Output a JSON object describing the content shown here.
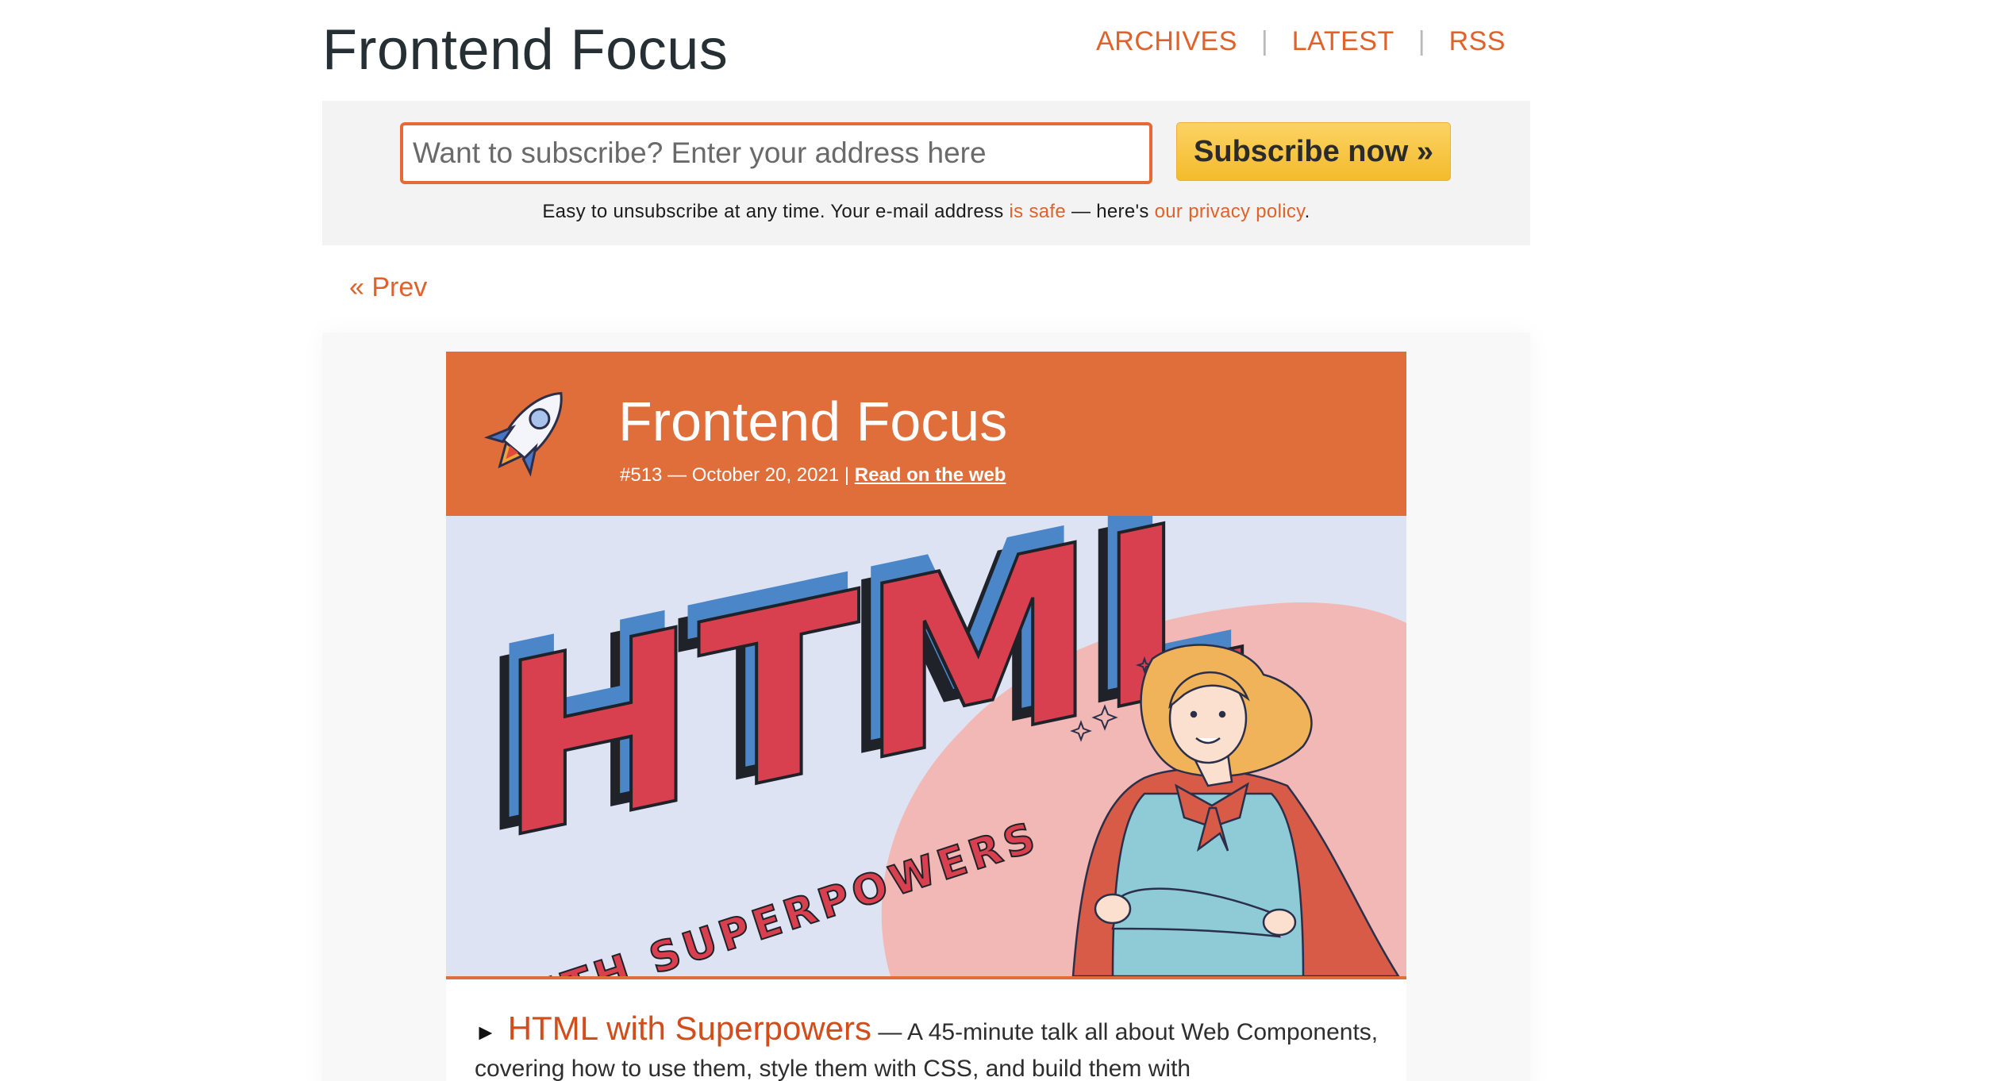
{
  "header": {
    "site_title": "Frontend Focus",
    "nav": {
      "archives": "ARCHIVES",
      "latest": "LATEST",
      "rss": "RSS",
      "separator": "|"
    }
  },
  "subscribe": {
    "placeholder": "Want to subscribe? Enter your address here",
    "value": "",
    "button_label": "Subscribe now »",
    "note_before": "Easy to unsubscribe at any time. Your e-mail address ",
    "note_link_safe": "is safe",
    "note_middle": " — here's ",
    "note_link_privacy": "our privacy policy",
    "note_end": "."
  },
  "pagination": {
    "prev_label": "« Prev"
  },
  "issue": {
    "title": "Frontend Focus",
    "meta_text": "#513 — October 20, 2021 | ",
    "read_on_web": "Read on the web",
    "hero_headline": "HTML",
    "hero_subline": "WITH SUPERPOWERS"
  },
  "articles": [
    {
      "bullet": "►",
      "title": "HTML with Superpowers",
      "description": " — A 45-minute talk all about Web Components, covering how to use them, style them with CSS, and build them with"
    }
  ],
  "colors": {
    "accent": "#e0622a",
    "header_bg": "#e06e3b",
    "button_yellow": "#f4bb2c",
    "hero_bg": "#dde3f3",
    "blob_pink": "#f2b8b5",
    "letter_red": "#d9404f",
    "letter_blue": "#4a86c8"
  },
  "icons": {
    "rocket": "rocket-icon"
  }
}
